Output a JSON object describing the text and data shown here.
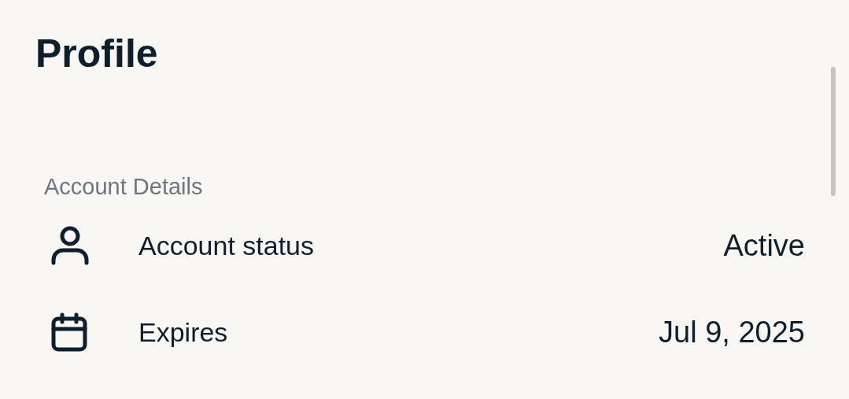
{
  "title": "Profile",
  "section": {
    "label": "Account Details",
    "rows": [
      {
        "kind": "person",
        "label": "Account status",
        "value": "Active"
      },
      {
        "kind": "calendar",
        "label": "Expires",
        "value": "Jul 9, 2025"
      }
    ]
  }
}
